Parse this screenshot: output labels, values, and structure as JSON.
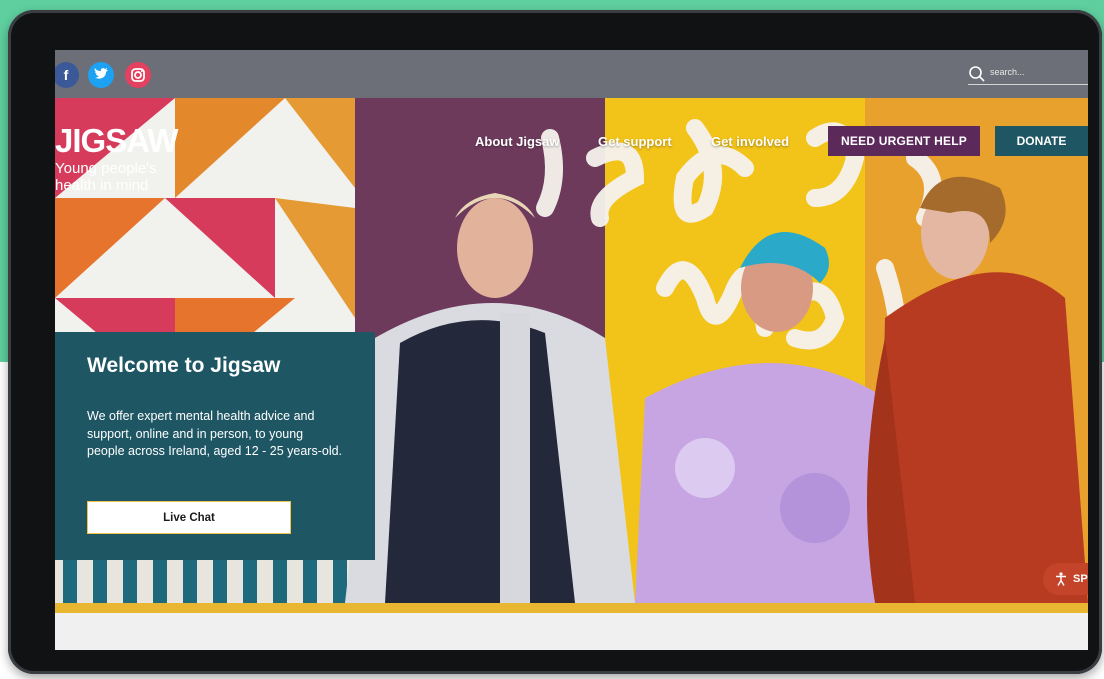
{
  "social": {
    "facebook": "f",
    "twitter_icon": "twitter-icon",
    "instagram_icon": "instagram-icon"
  },
  "search": {
    "placeholder": "search..."
  },
  "logo": {
    "main": "JIGSAW",
    "tagline": "Young people's health in mind"
  },
  "nav": {
    "items": [
      "About Jigsaw",
      "Get support",
      "Get involved"
    ],
    "urgent": "NEED URGENT HELP",
    "donate": "DONATE"
  },
  "hero": {
    "title": "Welcome to Jigsaw",
    "body": "We offer expert mental health advice and support, online and in person, to young people across Ireland, aged 12 - 25 years-old.",
    "cta": "Live Chat"
  },
  "accessibility": {
    "label": "SP"
  },
  "colors": {
    "background_teal": "#5fcf9f",
    "panel_teal": "#1e5664",
    "urgent_purple": "#5b2a5b",
    "donate_teal": "#1f5663",
    "gold_stripe": "#e8b631"
  }
}
